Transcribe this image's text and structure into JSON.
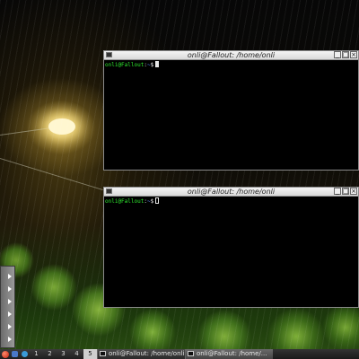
{
  "desktop": {
    "wallpaper": "rainy-night-streetlight"
  },
  "windows": [
    {
      "id": "terminal-top",
      "title": "onli@Fallout: /home/onli",
      "prompt_user": "onli@Fallout",
      "prompt_sep": ":",
      "prompt_path": "~",
      "prompt_symbol": "$",
      "buttons": [
        "_",
        "□",
        "×"
      ],
      "focused": false
    },
    {
      "id": "terminal-bottom",
      "title": "onli@Fallout: /home/onli",
      "prompt_user": "onli@Fallout",
      "prompt_sep": ":",
      "prompt_path": "~",
      "prompt_symbol": "$",
      "buttons": [
        "_",
        "□",
        "×"
      ],
      "focused": true
    }
  ],
  "taskbar": {
    "desktops": [
      "1",
      "2",
      "3",
      "4",
      "5"
    ],
    "active_desktop": "5",
    "tasks": [
      {
        "label": "onli@Fallout: /home/onli"
      },
      {
        "label": "onli@Fallout: /home/..."
      }
    ]
  },
  "colors": {
    "prompt_user": "#2ee82e",
    "prompt_path": "#5f8cff",
    "terminal_bg": "#000000"
  }
}
